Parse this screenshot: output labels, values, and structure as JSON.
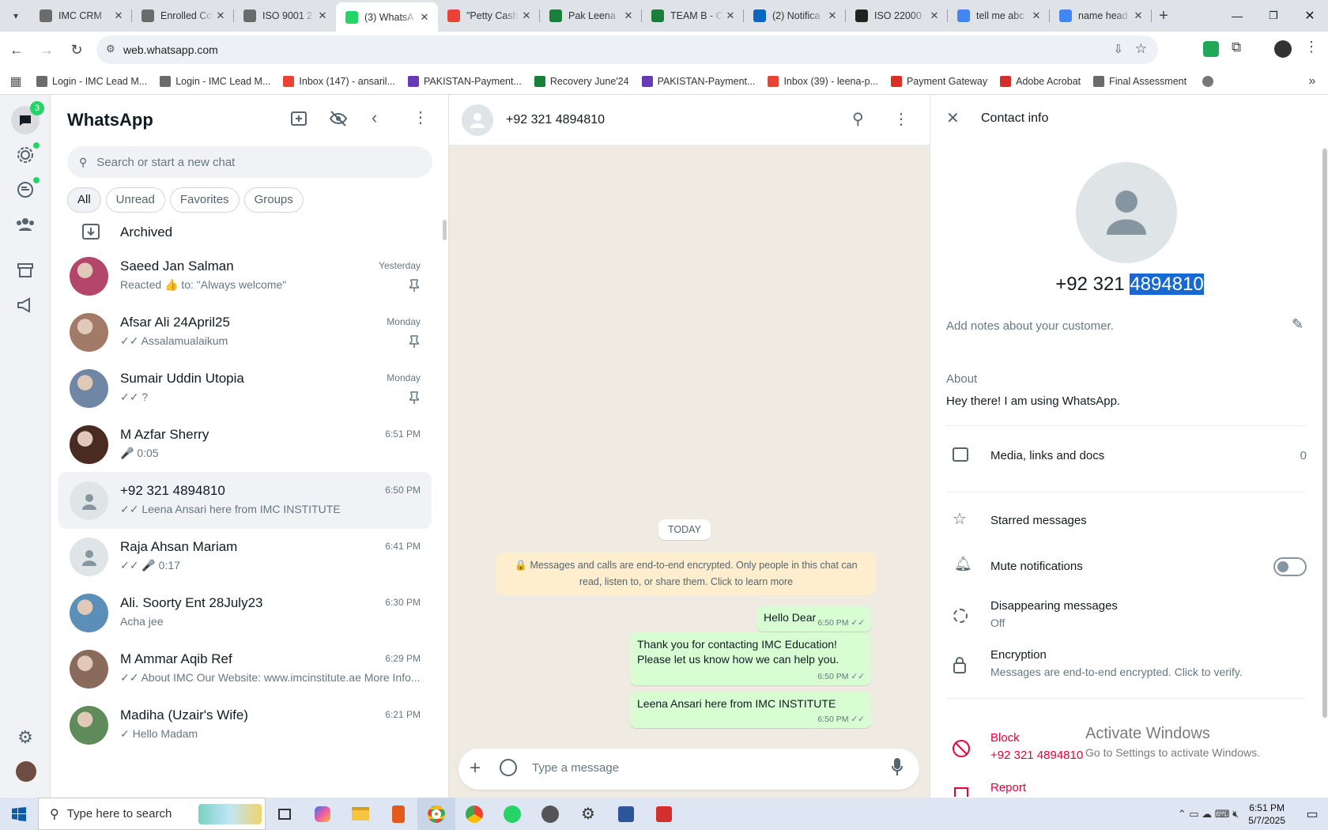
{
  "browser": {
    "tabs": [
      {
        "title": "IMC CRM",
        "icon": "imc-favicon",
        "color": "#6b6b6b"
      },
      {
        "title": "Enrolled Co",
        "icon": "imc-favicon",
        "color": "#6b6b6b"
      },
      {
        "title": "ISO 9001 2",
        "icon": "imc-favicon",
        "color": "#6b6b6b"
      },
      {
        "title": "(3) WhatsA",
        "icon": "whatsapp-favicon",
        "color": "#25d366",
        "active": true
      },
      {
        "title": "\"Petty Cash",
        "icon": "gmail-favicon",
        "color": "#ea4335"
      },
      {
        "title": "Pak Leena",
        "icon": "sheets-favicon",
        "color": "#188038"
      },
      {
        "title": "TEAM B - C",
        "icon": "sheets-favicon",
        "color": "#188038"
      },
      {
        "title": "(2) Notifica",
        "icon": "linkedin-favicon",
        "color": "#0a66c2"
      },
      {
        "title": "ISO 22000",
        "icon": "openai-favicon",
        "color": "#222"
      },
      {
        "title": "tell me abc",
        "icon": "google-favicon",
        "color": "#4285f4"
      },
      {
        "title": "name head",
        "icon": "google-favicon",
        "color": "#4285f4"
      }
    ],
    "url": "web.whatsapp.com",
    "bookmarks": [
      {
        "label": "Login - IMC Lead M...",
        "color": "#6b6b6b"
      },
      {
        "label": "Login - IMC Lead M...",
        "color": "#6b6b6b"
      },
      {
        "label": "Inbox (147) - ansaril...",
        "color": "#ea4335"
      },
      {
        "label": "PAKISTAN-Payment...",
        "color": "#673ab7"
      },
      {
        "label": "Recovery June'24",
        "color": "#188038"
      },
      {
        "label": "PAKISTAN-Payment...",
        "color": "#673ab7"
      },
      {
        "label": "Inbox (39) - leena-p...",
        "color": "#ea4335"
      },
      {
        "label": "Payment Gateway",
        "color": "#d93025"
      },
      {
        "label": "Adobe Acrobat",
        "color": "#d32f2f"
      },
      {
        "label": "Final Assessment",
        "color": "#6b6b6b"
      }
    ]
  },
  "rail": {
    "chats_badge": "3"
  },
  "sidebar": {
    "title": "WhatsApp",
    "search_placeholder": "Search or start a new chat",
    "filters": [
      "All",
      "Unread",
      "Favorites",
      "Groups"
    ],
    "archived_label": "Archived",
    "chats": [
      {
        "name": "Saeed Jan Salman",
        "preview": "Reacted 👍 to: \"Always welcome\"",
        "time": "Yesterday",
        "pinned": true,
        "avatar": "#b3466a"
      },
      {
        "name": "Afsar Ali 24April25",
        "preview": "✓✓ Assalamualaikum",
        "time": "Monday",
        "pinned": true,
        "avatar": "#a27a68"
      },
      {
        "name": "Sumair Uddin Utopia",
        "preview": "✓✓ ?",
        "time": "Monday",
        "pinned": true,
        "avatar": "#6f86a4"
      },
      {
        "name": "M Azfar Sherry",
        "preview": "🎤 0:05",
        "time": "6:51 PM",
        "pinned": false,
        "avatar": "#4a2b22"
      },
      {
        "name": "+92 321 4894810",
        "preview": "✓✓ Leena Ansari here from IMC INSTITUTE",
        "time": "6:50 PM",
        "pinned": false,
        "avatar": "default",
        "selected": true
      },
      {
        "name": "Raja Ahsan Mariam",
        "preview": "✓✓ 🎤 0:17",
        "time": "6:41 PM",
        "pinned": false,
        "avatar": "default"
      },
      {
        "name": "Ali. Soorty Ent 28July23",
        "preview": "Acha jee",
        "time": "6:30 PM",
        "pinned": false,
        "avatar": "#5b8fb8"
      },
      {
        "name": "M Ammar Aqib Ref",
        "preview": "✓✓ About IMC Our Website: www.imcinstitute.ae More Info...",
        "time": "6:29 PM",
        "pinned": false,
        "avatar": "#8a6a5a"
      },
      {
        "name": "Madiha (Uzair's Wife)",
        "preview": "✓ Hello Madam",
        "time": "6:21 PM",
        "pinned": false,
        "avatar": "#5f8a5a"
      }
    ]
  },
  "chat": {
    "contact": "+92 321 4894810",
    "date_chip": "TODAY",
    "encryption_notice": "🔒 Messages and calls are end-to-end encrypted. Only people in this chat can read, listen to, or share them. Click to learn more",
    "messages": [
      {
        "text": "Hello Dear",
        "time": "6:50 PM"
      },
      {
        "text": "Thank you for contacting IMC Education!\nPlease let us know how we can help you.",
        "time": "6:50 PM"
      },
      {
        "text": "Leena Ansari here from IMC INSTITUTE",
        "time": "6:50 PM"
      }
    ],
    "input_placeholder": "Type a message"
  },
  "contact_info": {
    "header": "Contact info",
    "phone_prefix": "+92 321",
    "phone_selected": "4894810",
    "notes_placeholder": "Add notes about your customer.",
    "about_label": "About",
    "about_text": "Hey there! I am using WhatsApp.",
    "media_label": "Media, links and docs",
    "media_count": "0",
    "starred_label": "Starred messages",
    "mute_label": "Mute notifications",
    "disappearing_label": "Disappearing messages",
    "disappearing_value": "Off",
    "encryption_label": "Encryption",
    "encryption_text": "Messages are end-to-end encrypted. Click to verify.",
    "block_label": "Block",
    "block_number": "+92 321 4894810",
    "report_label": "Report"
  },
  "watermark": {
    "title": "Activate Windows",
    "subtitle": "Go to Settings to activate Windows."
  },
  "taskbar": {
    "search_placeholder": "Type here to search",
    "time": "6:51 PM",
    "date": "5/7/2025"
  }
}
